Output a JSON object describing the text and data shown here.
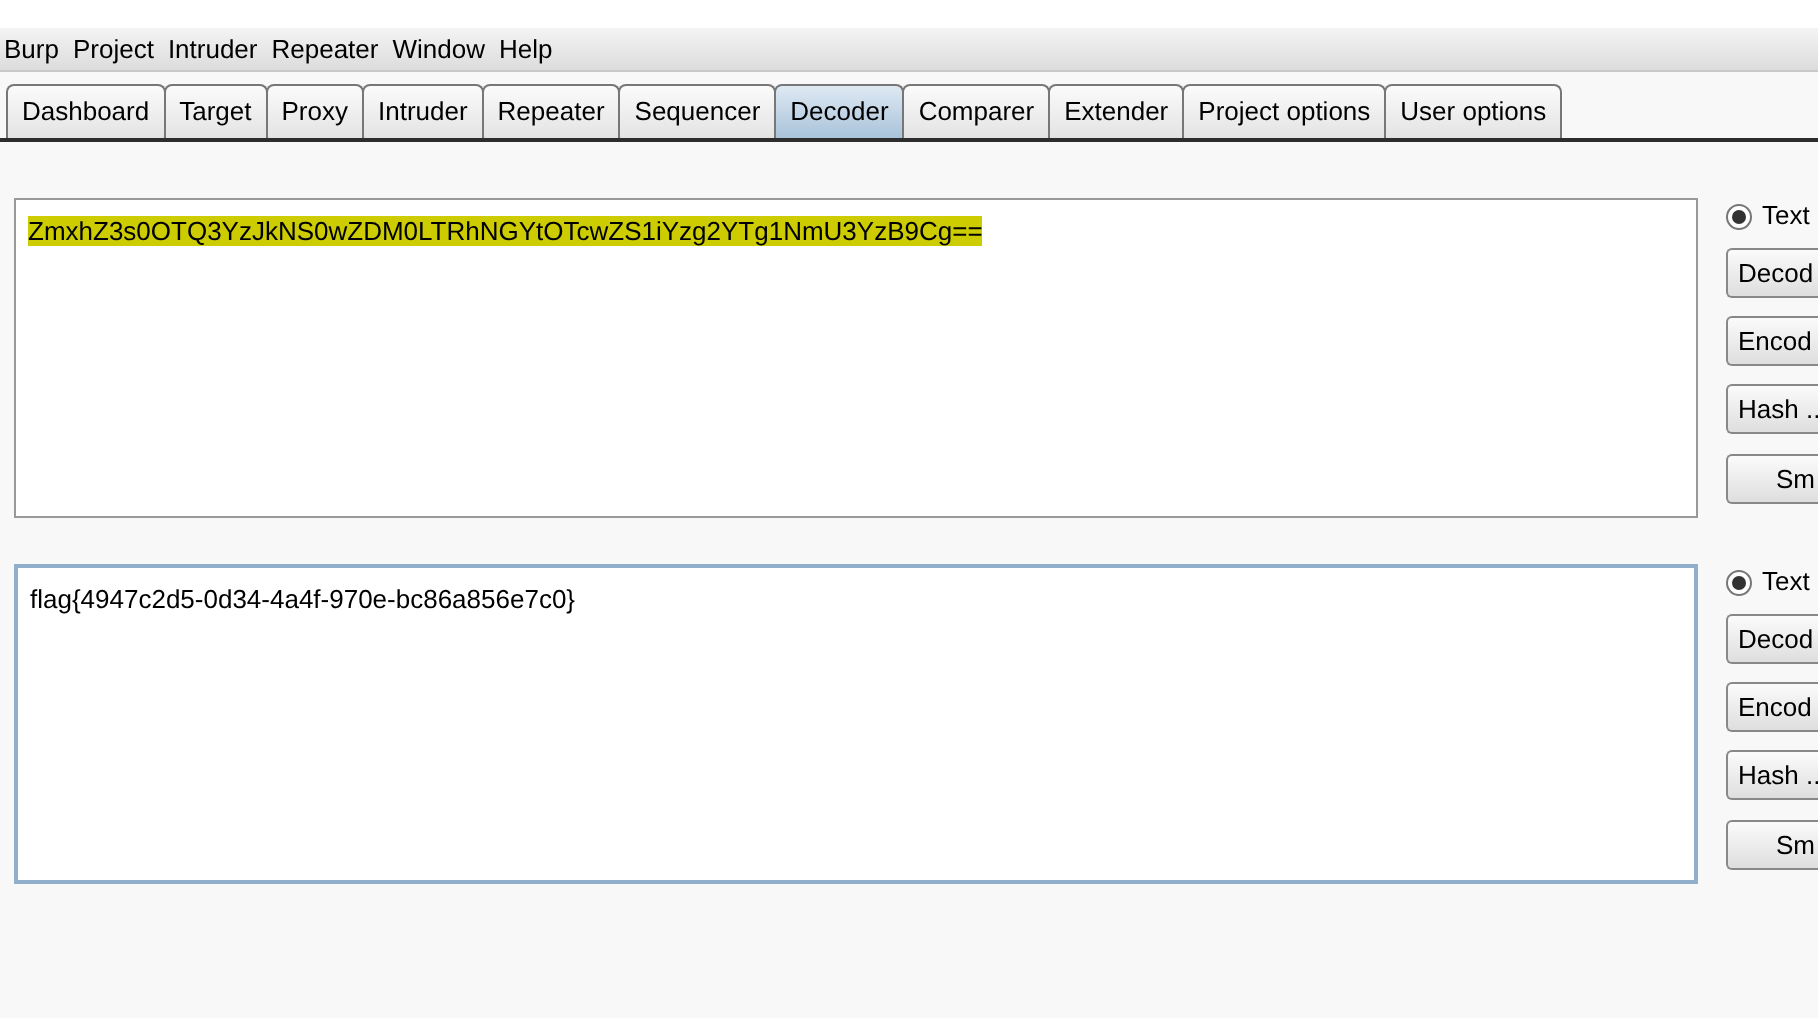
{
  "menu": [
    "Burp",
    "Project",
    "Intruder",
    "Repeater",
    "Window",
    "Help"
  ],
  "tabs": [
    {
      "label": "Dashboard",
      "selected": false
    },
    {
      "label": "Target",
      "selected": false
    },
    {
      "label": "Proxy",
      "selected": false
    },
    {
      "label": "Intruder",
      "selected": false
    },
    {
      "label": "Repeater",
      "selected": false
    },
    {
      "label": "Sequencer",
      "selected": false
    },
    {
      "label": "Decoder",
      "selected": true
    },
    {
      "label": "Comparer",
      "selected": false
    },
    {
      "label": "Extender",
      "selected": false
    },
    {
      "label": "Project options",
      "selected": false
    },
    {
      "label": "User options",
      "selected": false
    }
  ],
  "panels": [
    {
      "text": "ZmxhZ3s0OTQ3YzJkNS0wZDM0LTRhNGYtOTcwZS1iYzg2YTg1NmU3YzB9Cg==",
      "highlighted": true,
      "focused": false,
      "radio": {
        "label": "Text",
        "selected": true
      },
      "buttons": [
        "Decod",
        "Encod",
        "Hash ..",
        "Sm"
      ]
    },
    {
      "text": "flag{4947c2d5-0d34-4a4f-970e-bc86a856e7c0}",
      "highlighted": false,
      "focused": true,
      "radio": {
        "label": "Text",
        "selected": true
      },
      "buttons": [
        "Decod",
        "Encod",
        "Hash ..",
        "Sm"
      ]
    }
  ]
}
